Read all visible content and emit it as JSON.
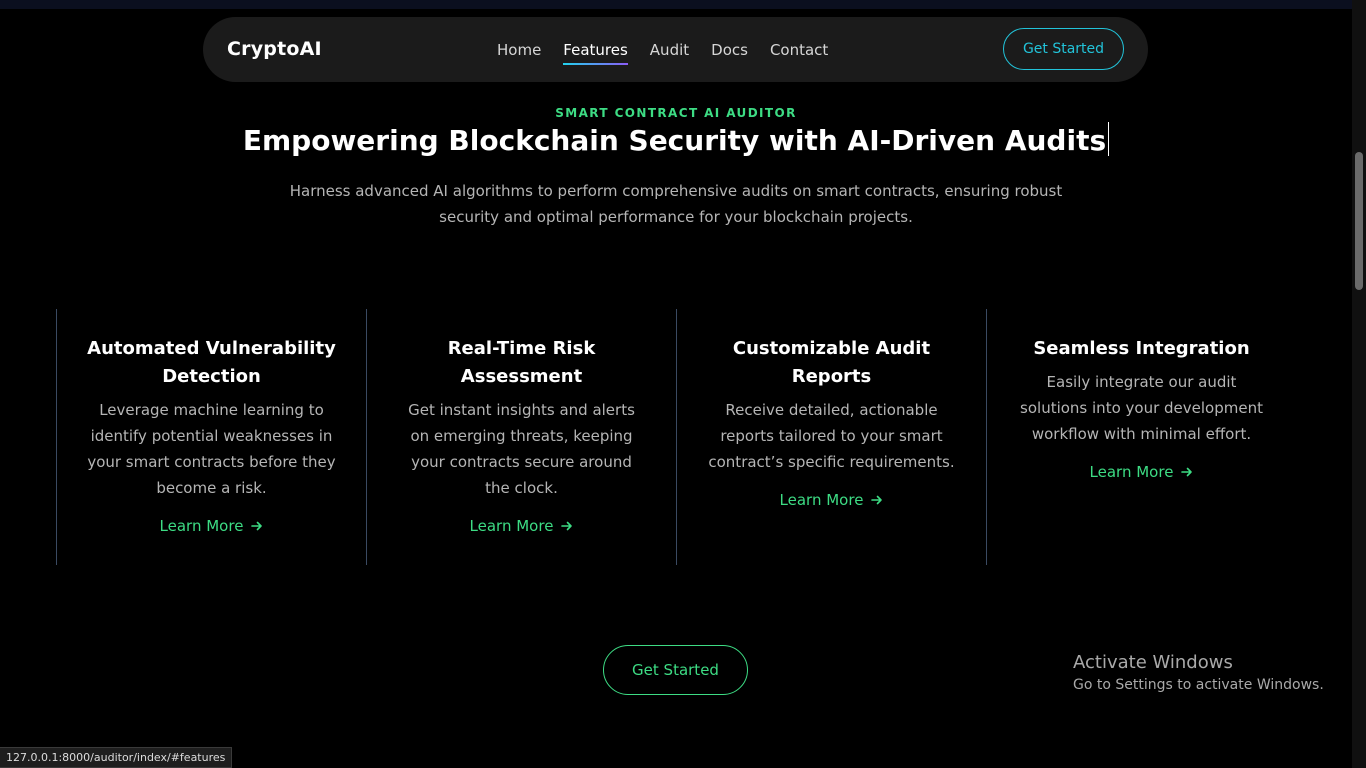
{
  "navbar": {
    "brand": "CryptoAI",
    "links": [
      {
        "label": "Home"
      },
      {
        "label": "Features"
      },
      {
        "label": "Audit"
      },
      {
        "label": "Docs"
      },
      {
        "label": "Contact"
      }
    ],
    "active_link": "Features",
    "cta_label": "Get Started"
  },
  "hero": {
    "eyebrow": "SMART CONTRACT AI AUDITOR",
    "title": "Empowering Blockchain Security with AI-Driven Audits",
    "subtitle": "Harness advanced AI algorithms to perform comprehensive audits on smart contracts, ensuring robust security and optimal performance for your blockchain projects."
  },
  "features": [
    {
      "title": "Automated Vulnerability Detection",
      "description": "Leverage machine learning to identify potential weaknesses in your smart contracts before they become a risk.",
      "link_label": "Learn More"
    },
    {
      "title": "Real-Time Risk Assessment",
      "description": "Get instant insights and alerts on emerging threats, keeping your contracts secure around the clock.",
      "link_label": "Learn More"
    },
    {
      "title": "Customizable Audit Reports",
      "description": "Receive detailed, actionable reports tailored to your smart contract’s specific requirements.",
      "link_label": "Learn More"
    },
    {
      "title": "Seamless Integration",
      "description": "Easily integrate our audit solutions into your development workflow with minimal effort.",
      "link_label": "Learn More"
    }
  ],
  "bottom_cta_label": "Get Started",
  "windows_watermark": {
    "title": "Activate Windows",
    "subtitle": "Go to Settings to activate Windows."
  },
  "status_url": "127.0.0.1:8000/auditor/index/#features",
  "icons": {
    "learn_more": "arrow-right-icon"
  },
  "colors": {
    "accent_green": "#3ddc84",
    "accent_cyan": "#22c3d9",
    "background": "#000000",
    "navbar_bg": "#1b1b1b"
  }
}
